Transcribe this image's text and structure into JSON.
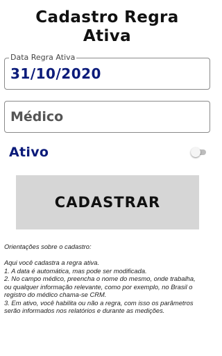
{
  "header": {
    "title_line1": "Cadastro Regra",
    "title_line2": "Ativa"
  },
  "form": {
    "date_field": {
      "label": "Data Regra Ativa",
      "value": "31/10/2020"
    },
    "doctor_field": {
      "placeholder": "Médico",
      "value": ""
    },
    "active_toggle": {
      "label": "Ativo",
      "checked": false
    },
    "submit_label": "CADASTRAR"
  },
  "instructions": {
    "intro": "Orientações sobre o cadastro:",
    "lines": [
      "Aqui você cadastra a regra ativa.",
      "1. A data é automática, mas pode ser modificada.",
      "2. No campo médico, preencha o nome do mesmo, onde trabalha,",
      "ou qualquer informação relevante, como por exemplo, no Brasil o",
      "registro do médico chama-se CRM.",
      "3. Em ativo, você habilita ou não a regra, com isso os parâmetros",
      "serão informados nos relatórios e durante as medições."
    ]
  },
  "colors": {
    "accent_text": "#0b1b7a",
    "button_bg": "#d6d6d6",
    "border": "#8a8a8a"
  }
}
